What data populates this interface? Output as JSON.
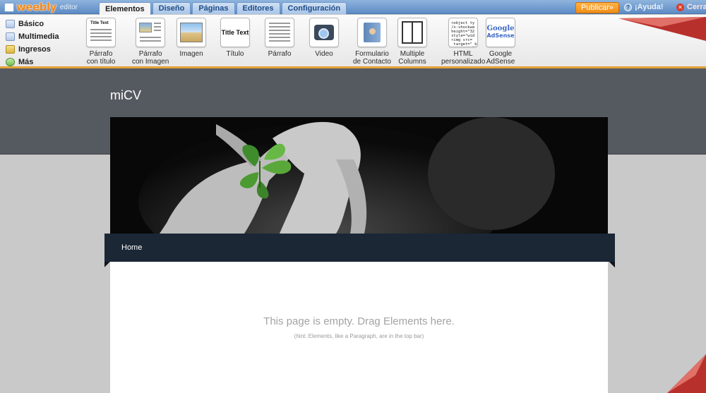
{
  "app": {
    "logo": "weebly",
    "logo_suffix": "editor"
  },
  "tabs": [
    {
      "label": "Elementos",
      "active": true
    },
    {
      "label": "Diseño",
      "active": false
    },
    {
      "label": "Páginas",
      "active": false
    },
    {
      "label": "Editores",
      "active": false
    },
    {
      "label": "Configuración",
      "active": false
    }
  ],
  "actions": {
    "publish": "Publicar»",
    "help": "¡Ayuda!",
    "close": "Cerra"
  },
  "categories": [
    "Básico",
    "Multimedia",
    "Ingresos",
    "Más"
  ],
  "elements": [
    {
      "label_1": "Párrafo",
      "label_2": "con título",
      "thumb_title": "Title Text"
    },
    {
      "label_1": "Párrafo",
      "label_2": "con Imagen"
    },
    {
      "label_1": "Imagen",
      "label_2": ""
    },
    {
      "label_1": "Título",
      "label_2": "",
      "thumb_title": "Title Text"
    },
    {
      "label_1": "Párrafo",
      "label_2": ""
    },
    {
      "label_1": "Video",
      "label_2": ""
    },
    {
      "label_1": "Formulario",
      "label_2": "de Contacto"
    },
    {
      "label_1": "Multiple",
      "label_2": "Columns"
    },
    {
      "label_1": "HTML",
      "label_2": "personalizado",
      "thumb_code": "<object ty\n/x-shockwa\nheight=\"32\nstyle=\"wid\n<img src=\n target=\"_b"
    },
    {
      "label_1": "Google",
      "label_2": "AdSense",
      "thumb_brand": "Google",
      "thumb_brand_2": "AdSense"
    }
  ],
  "site": {
    "title": "miCV",
    "nav_home": "Home",
    "empty_message": "This page is empty. Drag Elements here.",
    "hint": "(hint: Elements, like a Paragraph, are in the top bar)"
  },
  "colors": {
    "accent": "#f08c16",
    "topbar": "#5d8bc4",
    "header_band": "#555a60",
    "nav": "#1b2735"
  }
}
